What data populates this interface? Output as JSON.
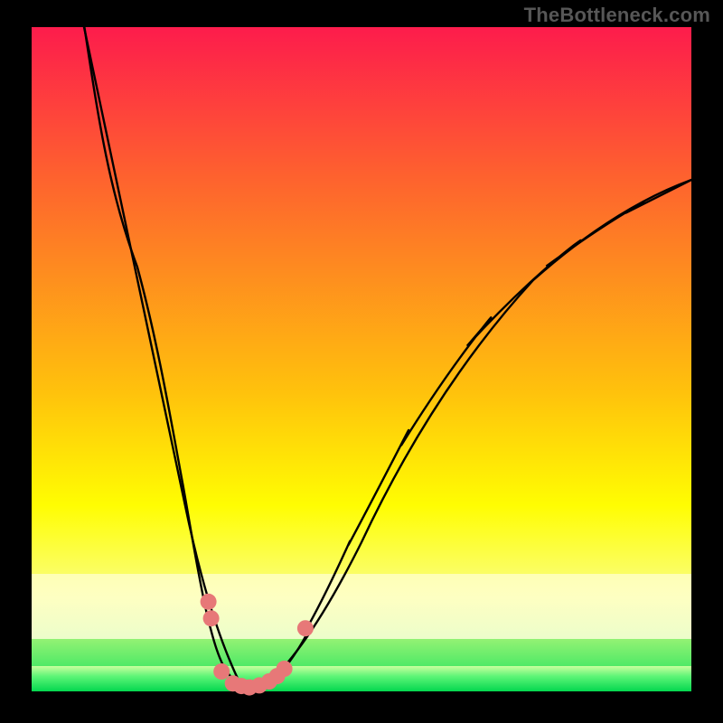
{
  "watermark": "TheBottleneck.com",
  "chart_data": {
    "type": "line",
    "title": "",
    "xlabel": "",
    "ylabel": "",
    "x_range": [
      0,
      100
    ],
    "y_range": [
      0,
      100
    ],
    "grid": false,
    "legend": false,
    "annotations": [],
    "background_gradient": {
      "colors": [
        "#fd1c4c",
        "#fe602f",
        "#ffc20c",
        "#fffd02",
        "#f9ff88",
        "#10e15a"
      ],
      "stops": [
        0,
        0.22,
        0.55,
        0.72,
        0.86,
        1.0
      ]
    },
    "curve_left": {
      "description": "Steep falling curve from top-left toward valley",
      "points": [
        {
          "x": 8.0,
          "y": 100.0
        },
        {
          "x": 12.0,
          "y": 80.0
        },
        {
          "x": 16.0,
          "y": 62.0
        },
        {
          "x": 20.0,
          "y": 45.0
        },
        {
          "x": 23.0,
          "y": 31.0
        },
        {
          "x": 25.0,
          "y": 20.0
        },
        {
          "x": 26.5,
          "y": 12.0
        },
        {
          "x": 28.0,
          "y": 6.0
        },
        {
          "x": 30.0,
          "y": 2.0
        },
        {
          "x": 32.0,
          "y": 0.5
        }
      ]
    },
    "curve_right": {
      "description": "Rising curve from valley toward upper-right, flattening",
      "points": [
        {
          "x": 35.0,
          "y": 0.5
        },
        {
          "x": 38.0,
          "y": 3.0
        },
        {
          "x": 42.0,
          "y": 10.0
        },
        {
          "x": 48.0,
          "y": 22.0
        },
        {
          "x": 56.0,
          "y": 37.0
        },
        {
          "x": 66.0,
          "y": 52.0
        },
        {
          "x": 78.0,
          "y": 64.0
        },
        {
          "x": 90.0,
          "y": 72.0
        },
        {
          "x": 100.0,
          "y": 77.0
        }
      ]
    },
    "highlight_points": {
      "description": "Salmon dots near the valley region",
      "points": [
        {
          "x": 26.8,
          "y": 13.5
        },
        {
          "x": 27.2,
          "y": 11.0
        },
        {
          "x": 28.8,
          "y": 3.0
        },
        {
          "x": 30.5,
          "y": 1.2
        },
        {
          "x": 31.8,
          "y": 0.8
        },
        {
          "x": 33.0,
          "y": 0.6
        },
        {
          "x": 34.5,
          "y": 0.9
        },
        {
          "x": 36.0,
          "y": 1.5
        },
        {
          "x": 37.2,
          "y": 2.3
        },
        {
          "x": 38.3,
          "y": 3.4
        },
        {
          "x": 41.5,
          "y": 9.5
        }
      ]
    },
    "inner_band": {
      "pale_band_y_range": [
        82,
        90
      ],
      "green_band_y_range": [
        0,
        4
      ]
    }
  }
}
